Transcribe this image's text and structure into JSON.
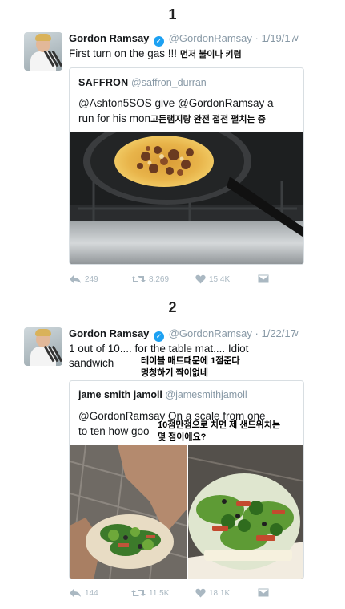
{
  "sections": [
    "1",
    "2"
  ],
  "tweet1": {
    "author": "Gordon Ramsay",
    "handle": "@GordonRamsay",
    "date": "· 1/19/17",
    "text": "First turn on the gas !!!",
    "translation": "먼저 불이나 키렴",
    "quote": {
      "author": "SAFFRON",
      "handle": "@saffron_durran",
      "text_line1": "@Ashton5SOS give @GordonRamsay a",
      "text_line2": "run for his mon",
      "translation": "고든램지랑 완전 접전 펼치는 중"
    },
    "replies": "249",
    "retweets": "8,269",
    "likes": "15.4K"
  },
  "tweet2": {
    "author": "Gordon Ramsay",
    "handle": "@GordonRamsay",
    "date": "· 1/22/17",
    "text_line1": "1 out of 10.... for the table mat.... Idiot",
    "text_line2": "sandwich",
    "translation_line1": "테이블 매트때문에 1점준다",
    "translation_line2": "멍청하기 짝이없네",
    "quote": {
      "author": "jame smith jamoll",
      "handle": "@jamesmithjamoll",
      "text_line1": "@GordonRamsay On a scale from one",
      "text_line2": "to ten how goo",
      "translation_line1": "10점만점으로 치면 제 샌드위치는",
      "translation_line2": "몇 점이에요?"
    },
    "replies": "144",
    "retweets": "11.5K",
    "likes": "18.1K"
  },
  "icons": [
    "reply-icon",
    "retweet-icon",
    "like-icon",
    "dm-icon",
    "chevron-down-icon",
    "verified-badge-icon"
  ],
  "colors": {
    "brand_blue": "#1da1f2",
    "muted": "#8899a6",
    "action_gray": "#aab8c2"
  }
}
